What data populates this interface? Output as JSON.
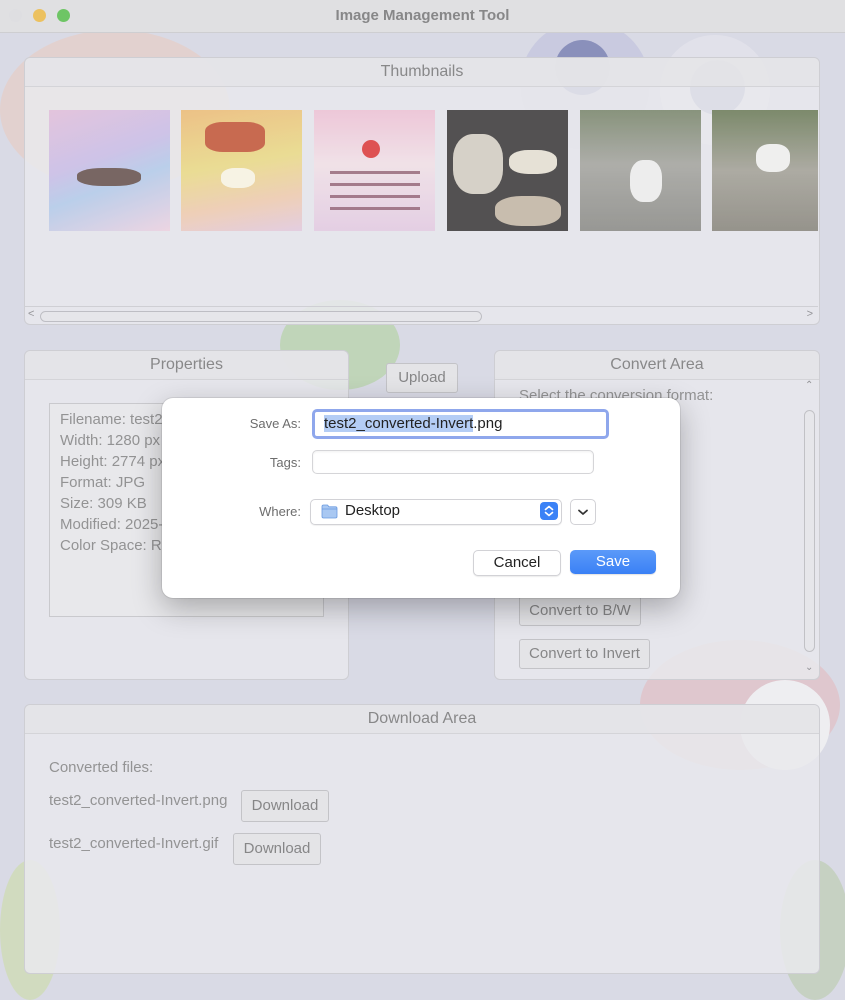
{
  "window": {
    "title": "Image Management Tool",
    "traffic_colors": [
      "#e2e2e4",
      "#f2c04c",
      "#5fc553"
    ]
  },
  "thumbnails_panel": {
    "header": "Thumbnails",
    "scroll_left": "<",
    "scroll_right": ">"
  },
  "properties_panel": {
    "header": "Properties",
    "lines": [
      "Filename: test2.",
      "Width: 1280 px",
      "Height: 2774 px",
      "Format: JPG",
      "Size: 309 KB",
      "Modified: 2025-",
      "Color Space: RG"
    ]
  },
  "upload_button": {
    "label": "Upload"
  },
  "convert_panel": {
    "header": "Convert Area",
    "prompt": "Select the conversion format:",
    "buttons": [
      "Convert to B/W",
      "Convert to Invert"
    ]
  },
  "download_panel": {
    "header": "Download Area",
    "converted_label": "Converted files:",
    "files": [
      {
        "name": "test2_converted-Invert.png",
        "button": "Download"
      },
      {
        "name": "test2_converted-Invert.gif",
        "button": "Download"
      }
    ]
  },
  "save_dialog": {
    "save_as_label": "Save As:",
    "filename_selected": "test2_converted-Invert",
    "filename_ext": ".png",
    "tags_label": "Tags:",
    "tags_value": "",
    "where_label": "Where:",
    "where_value": "Desktop",
    "cancel_label": "Cancel",
    "save_label": "Save",
    "accent_color": "#3a80f5"
  }
}
